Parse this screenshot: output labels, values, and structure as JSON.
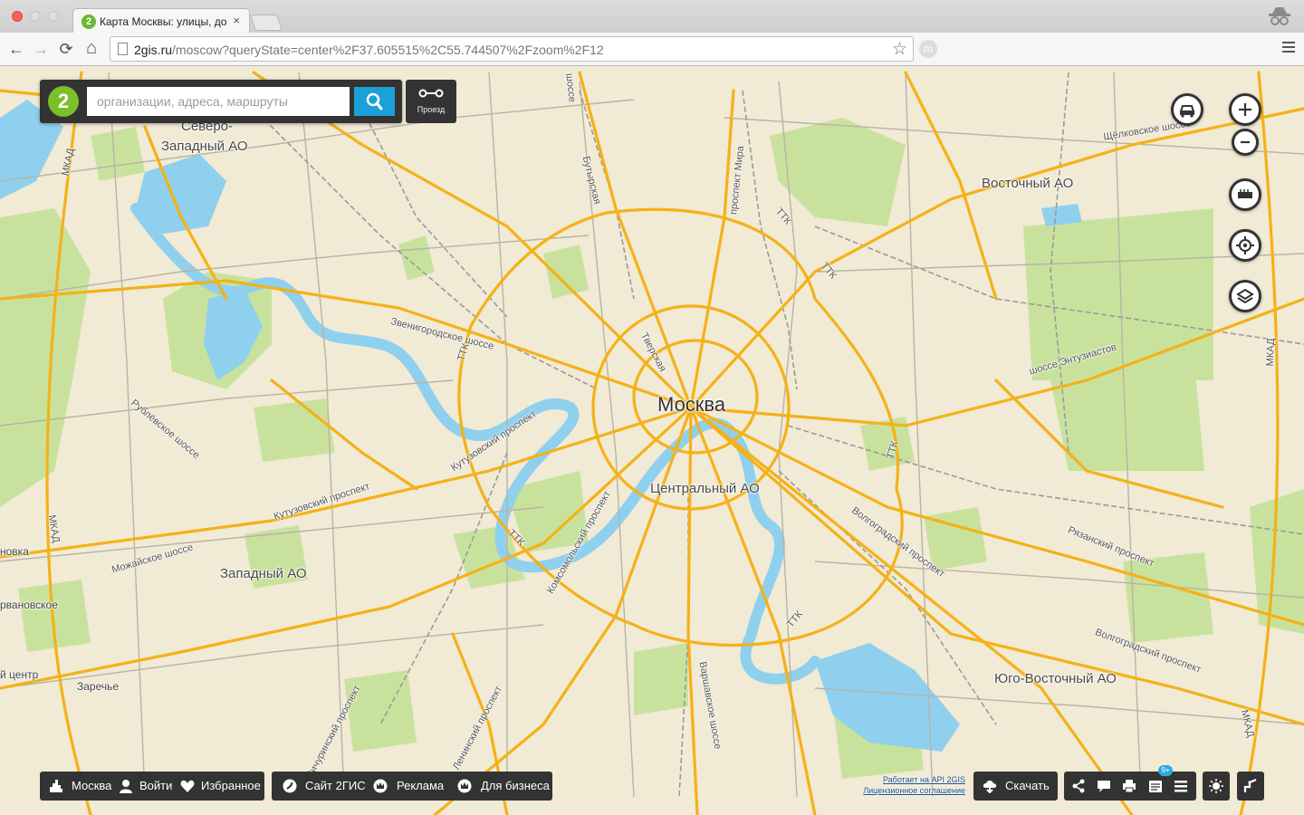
{
  "browser": {
    "tab_title": "Карта Москвы: улицы, дома",
    "tab_favicon": "2",
    "tab_close": "×",
    "url_host": "2gis.ru",
    "url_path": "/moscow?queryState=center%2F37.605515%2C55.744507%2Fzoom%2F12",
    "buttons": {
      "back": "←",
      "forward": "→",
      "reload": "⟳",
      "home": "⌂",
      "bookmark": "☆"
    },
    "extension_letter": "m",
    "icons": [
      "back-icon",
      "forward-icon",
      "reload-icon",
      "home-icon",
      "star-icon",
      "incognito-icon",
      "menu-icon"
    ]
  },
  "search": {
    "logo": "2",
    "placeholder": "организации, адреса, маршруты",
    "route_label": "Проезд",
    "icons": [
      "search-icon",
      "route-icon"
    ]
  },
  "map": {
    "city": "Москва",
    "districts": [
      "Северо-",
      "Западный АО",
      "Восточный АО",
      "Центральный АО",
      "Западный АО",
      "Юго-Восточный АО"
    ],
    "roads": [
      "Щёлковское шоссе",
      "Звенигородское шоссе",
      "Тверская",
      "Кутузовский проспект",
      "Кутузовский проспект",
      "Рублёвское шоссе",
      "Можайское шоссе",
      "Комсомольский проспект",
      "ТТК",
      "ТТК",
      "ТТК",
      "ТТК",
      "ТТК",
      "ТТК",
      "шоссе Энтузиастов",
      "Волгоградский проспект",
      "Рязанский проспект",
      "Волгоградский проспект",
      "Варшавское шоссе",
      "Ленинский проспект",
      "Мичуринский проспект",
      "Бутырская",
      "проспект Мира",
      "МКАД",
      "МКАД",
      "МКАД",
      "МКАД",
      "шоссе"
    ],
    "side_labels": [
      "новка",
      "рвановское",
      "й центр",
      "Заречье"
    ],
    "colors": {
      "land": "#f1ead5",
      "park": "#c8e29e",
      "water": "#8fd0ee",
      "major_road": "#f5b117",
      "minor_road": "#b8b3a4",
      "rail": "#9a9a9a"
    }
  },
  "controls": {
    "icons": [
      "traffic-icon",
      "zoom-in-icon",
      "zoom-out-icon",
      "ruler-icon",
      "locate-icon",
      "layers-icon"
    ],
    "zoom_in": "+",
    "zoom_out": "−"
  },
  "bottom": {
    "city": "Москва",
    "login": "Войти",
    "favorites": "Избранное",
    "site": "Сайт 2ГИС",
    "ads": "Реклама",
    "business": "Для бизнеса",
    "download": "Скачать",
    "api_link": "Работает на API 2GIS",
    "license_link": "Лицензионное соглашение",
    "badge": "9+",
    "icons": [
      "city-icon",
      "user-icon",
      "heart-icon",
      "2gis-icon",
      "crown-icon",
      "crown-business-icon",
      "download-icon",
      "share-icon",
      "comment-icon",
      "print-icon",
      "news-icon",
      "list-icon",
      "brightness-icon",
      "ruler-measure-icon"
    ]
  }
}
